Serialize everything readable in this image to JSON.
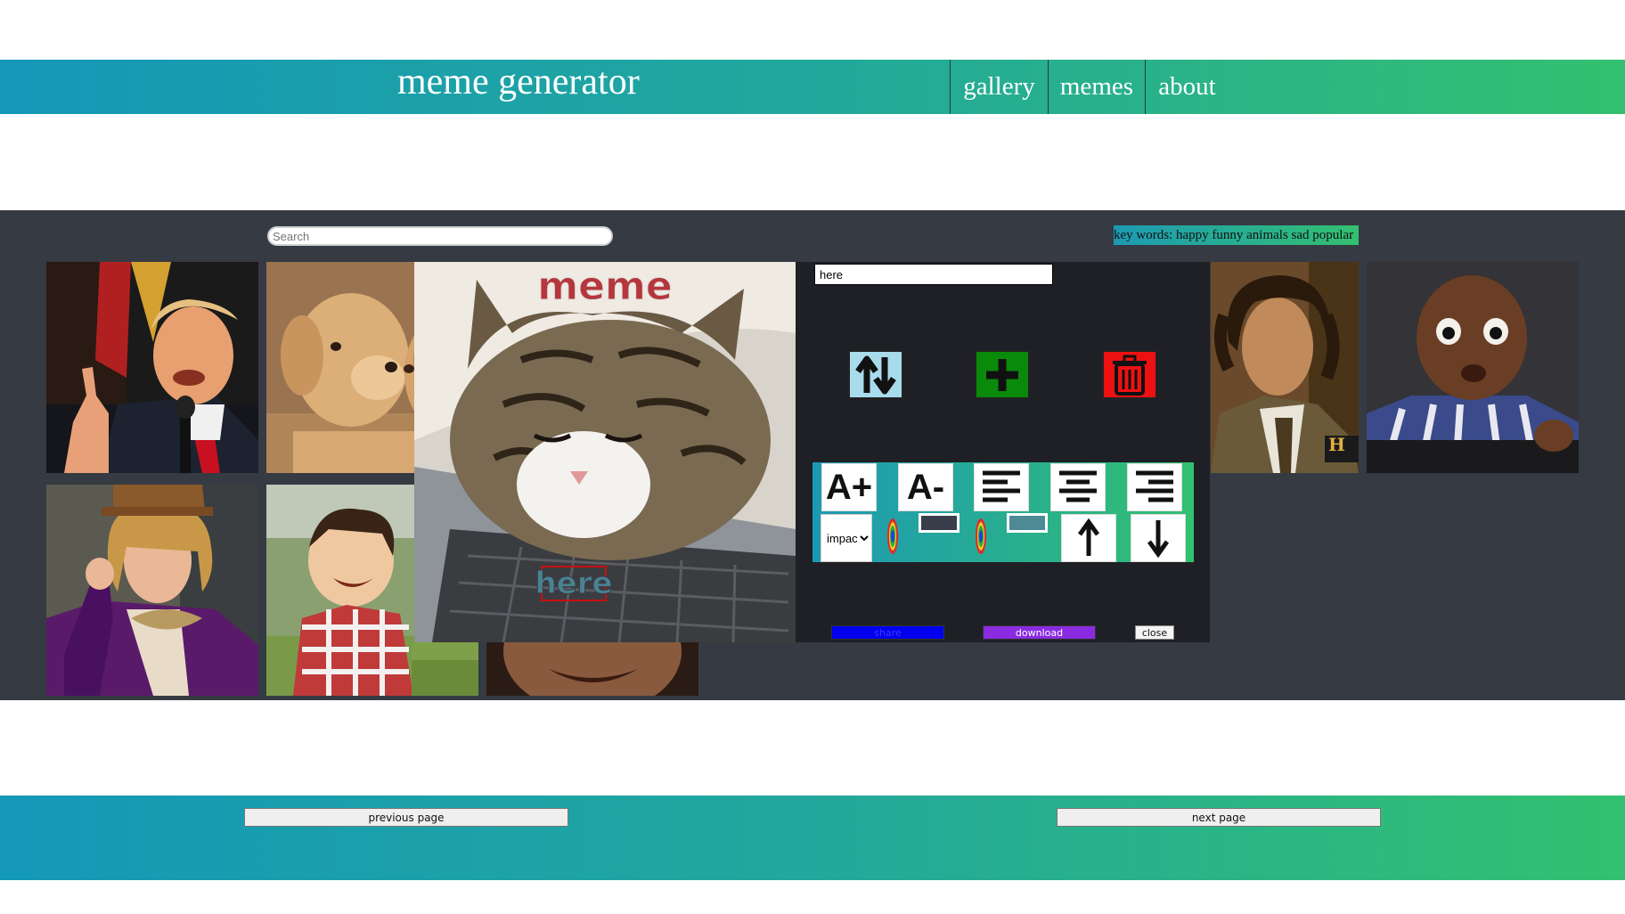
{
  "header": {
    "title": "meme generator",
    "nav": [
      {
        "label": "gallery"
      },
      {
        "label": "memes"
      },
      {
        "label": "about"
      }
    ]
  },
  "search": {
    "placeholder": "Search"
  },
  "keywords": {
    "text": "key words: happy funny animals sad popular"
  },
  "gallery": {
    "images": [
      {
        "name": "trump-meme-thumb"
      },
      {
        "name": "puppies-meme-thumb"
      },
      {
        "name": "wonka-meme-thumb"
      },
      {
        "name": "evil-toddler-meme-thumb"
      },
      {
        "name": "aliens-guy-meme-thumb"
      },
      {
        "name": "surprised-baby-meme-thumb"
      }
    ]
  },
  "editor": {
    "top_text": "meme",
    "bottom_text": "here",
    "line_input_value": "here",
    "font_options": [
      "impact"
    ],
    "font_selected": "impact",
    "tools": {
      "increase_font": "A+",
      "decrease_font": "A-"
    },
    "swatches": {
      "stroke": "#3a3d4a",
      "fill": "#4d8a96"
    },
    "share_label": "share",
    "download_label": "download",
    "close_label": "close"
  },
  "footer": {
    "prev_label": "previous page",
    "next_label": "next page"
  },
  "colors": {
    "gradient_start": "#1498b8",
    "gradient_end": "#33c070",
    "panel_bg": "#363a42",
    "editor_bg": "#1e2026",
    "share_color": "#0000ee",
    "download_color": "#8a2be2",
    "switch_button": "#a8dcec",
    "add_button": "#0a8a0a",
    "delete_button": "#ee1111"
  }
}
